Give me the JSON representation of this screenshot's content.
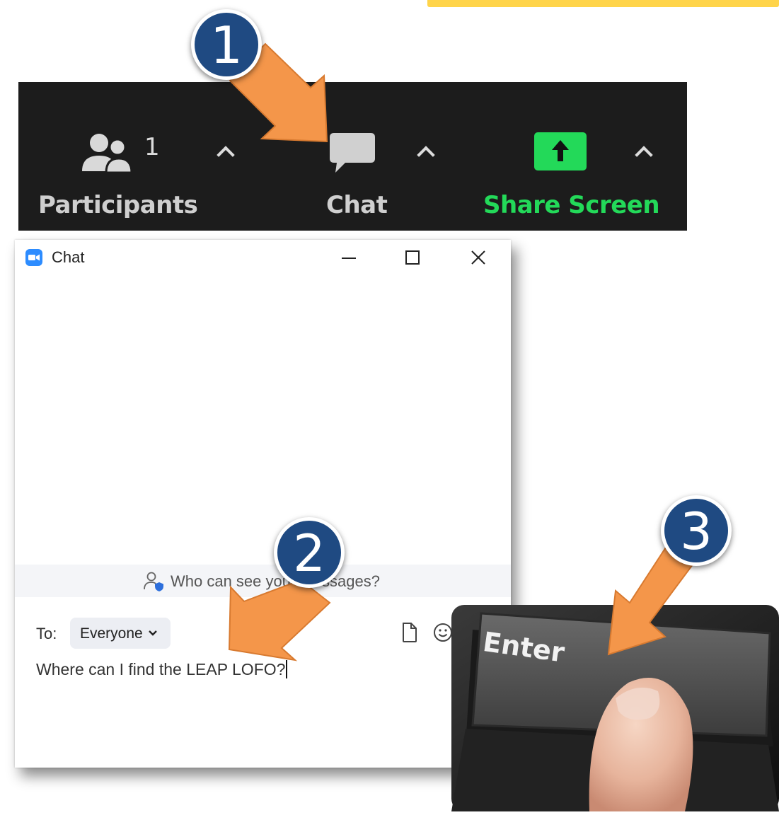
{
  "toolbar": {
    "participants": {
      "label": "Participants",
      "count": "1",
      "icon": "participants-icon"
    },
    "chat": {
      "label": "Chat",
      "icon": "chat-bubble-icon"
    },
    "share": {
      "label": "Share Screen",
      "icon": "share-screen-icon"
    }
  },
  "chat_window": {
    "title": "Chat",
    "privacy_text": "Who can see your messages?",
    "to_label": "To:",
    "recipient": "Everyone",
    "message": "Where can I find the LEAP LOFO?"
  },
  "photo": {
    "key_label": "Enter"
  },
  "steps": [
    "1",
    "2",
    "3"
  ],
  "colors": {
    "toolbar_bg": "#1c1c1c",
    "share_green": "#23d959",
    "arrow_orange": "#f4964a",
    "badge_blue": "#1f4a82",
    "accent_yellow": "#ffd44a",
    "zoom_blue": "#2d8cff"
  }
}
